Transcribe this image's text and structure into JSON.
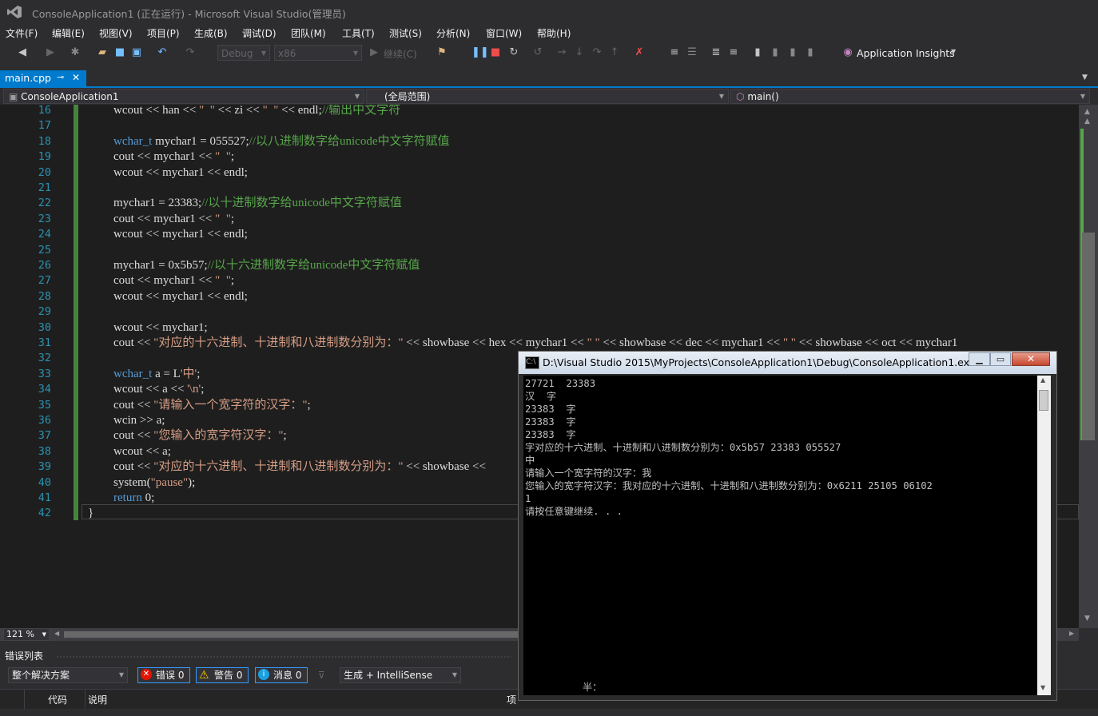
{
  "window": {
    "title": "ConsoleApplication1 (正在运行) - Microsoft Visual Studio(管理员)"
  },
  "menu": [
    "文件(F)",
    "编辑(E)",
    "视图(V)",
    "项目(P)",
    "生成(B)",
    "调试(D)",
    "团队(M)",
    "工具(T)",
    "测试(S)",
    "分析(N)",
    "窗口(W)",
    "帮助(H)"
  ],
  "toolbar": {
    "config": "Debug",
    "platform": "x86",
    "continue_label": "继续(C)",
    "app_insights": "Application Insights"
  },
  "tabs": {
    "active": "main.cpp",
    "pin": "⊸",
    "close": "✕"
  },
  "nav": {
    "project": "ConsoleApplication1",
    "scope": "(全局范围)",
    "member": "main()"
  },
  "editor": {
    "line_numbers": [
      "16",
      "17",
      "18",
      "19",
      "20",
      "21",
      "22",
      "23",
      "24",
      "25",
      "26",
      "27",
      "28",
      "29",
      "30",
      "31",
      "32",
      "33",
      "34",
      "35",
      "36",
      "37",
      "38",
      "39",
      "40",
      "41",
      "42"
    ],
    "zoom": "121 %"
  },
  "console": {
    "title": "D:\\Visual Studio 2015\\MyProjects\\ConsoleApplication1\\Debug\\ConsoleApplication1.exe",
    "lines": [
      "27721  23383",
      "汉  字",
      "23383  字",
      "23383  字",
      "23383  字",
      "字对应的十六进制、十进制和八进制数分别为：0x5b57 23383 055527",
      "中",
      "请输入一个宽字符的汉字：我",
      "您输入的宽字符汉字：我对应的十六进制、十进制和八进制数分别为：0x6211 25105 06102",
      "1",
      "请按任意键继续. . ."
    ],
    "ime": "半："
  },
  "error_list": {
    "title": "错误列表",
    "scope": "整个解决方案",
    "errors": "错误 0",
    "warnings": "警告 0",
    "messages": "消息 0",
    "source": "生成 + IntelliSense",
    "col_code": "代码",
    "col_desc": "说明",
    "col_project": "项"
  },
  "colors": {
    "accent": "#007acc",
    "editor_bg": "#1e1e1e",
    "keyword": "#569cd6",
    "string": "#d69d85",
    "comment": "#57a64a"
  }
}
